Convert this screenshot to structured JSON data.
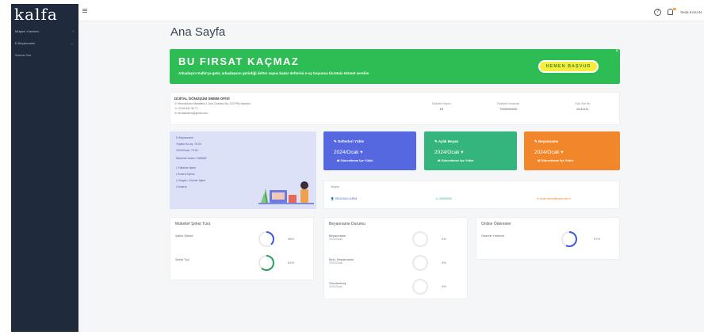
{
  "sidebar": {
    "logo": "kalfa",
    "items": [
      {
        "label": "Müşteri Yönetimi"
      },
      {
        "label": "E-Beyanname"
      },
      {
        "label": "Sorunu Sor"
      }
    ]
  },
  "header": {
    "help_glyph": "?",
    "user_name": "Seda KAKAN"
  },
  "page": {
    "title": "Ana Sayfa"
  },
  "banner": {
    "title": "BU FIRSAT KAÇMAZ",
    "subtitle": "Arkadaşını Kalfa'ya getir, arkadaşının getirdiği defter sayısı kadar defterini e-uy boyunca Ücretsiz Hizmet verelim",
    "button_label": "HEMEN BAŞVUR",
    "close": "×",
    "color": "#2ebd55"
  },
  "office": {
    "name": "DİJİTAL DÖNÜŞÜM SMMM OFİSİ",
    "address": "Hüsnüsözen Mahallesi 1.Ana Caddesi No:1/23 Pilk İstanbul",
    "phone": "0216 842 36 71",
    "email": "serdasistem@gmail.com",
    "stats": [
      {
        "label": "Mükellef Sayısı",
        "value": "18"
      },
      {
        "label": "Faaliyet Numarası",
        "value": "7000000000"
      },
      {
        "label": "Oda Sicil No",
        "value": "11111111"
      }
    ]
  },
  "welcome": {
    "lines": [
      "E-Beyanname",
      "Toplam Bu ay: 75.00",
      "2024/Ocak: 75.00",
      "Bekleme Kalan: KABBAT",
      "• Yükleme İşlem",
      "• Kontrol İşlemi",
      "• Onayla / Gönder İşlem",
      "• Kontrol"
    ]
  },
  "tiles": [
    {
      "title": "Defterleri Yükle",
      "period": "2024/Ocak ▾",
      "link": "Güncelleme İşe Yükle",
      "color": "#5568df"
    },
    {
      "title": "Aylık Beyan",
      "period": "2024/Ocak ▾",
      "link": "Güncelleme İşe Yükle",
      "color": "#35b57e"
    },
    {
      "title": "Beyanname",
      "period": "2024/Ocak ▾",
      "link": "Güncelleme İşe Yükle",
      "color": "#f2862a"
    }
  ],
  "contact": {
    "heading": "İletişim",
    "person": "SEDA BULLARIM",
    "phone": "05000000",
    "email": "seda.ozkan@kalfa.com.tr"
  },
  "panels": {
    "mukellef": {
      "title": "Mükellef Şirket Türü",
      "rows": [
        {
          "label": "Şahıs Şirketi",
          "value": "38%",
          "percent": 38,
          "color": "#3b5bdb"
        },
        {
          "label": "Şirket Tipi",
          "value": "61%",
          "percent": 61,
          "color": "#2fa05a"
        }
      ]
    },
    "beyanname": {
      "title": "Beyanname Durumu",
      "rows": [
        {
          "label": "Beyanname",
          "sub": "2024/Ocak",
          "value": "0%",
          "percent": 0,
          "color": "#bbb"
        },
        {
          "label": "Muh. Beyanname",
          "sub": "2024/Ocak",
          "value": "0%",
          "percent": 0,
          "color": "#bbb"
        },
        {
          "label": "Gönderilmiş",
          "sub": "2024/Ocak",
          "value": "0%",
          "percent": 0,
          "color": "#bbb"
        }
      ]
    },
    "online": {
      "title": "Online Ödemeler",
      "rows": [
        {
          "label": "Ödeme Yöntemi",
          "value": "57%",
          "percent": 57,
          "color": "#3b5bdb"
        }
      ]
    }
  }
}
